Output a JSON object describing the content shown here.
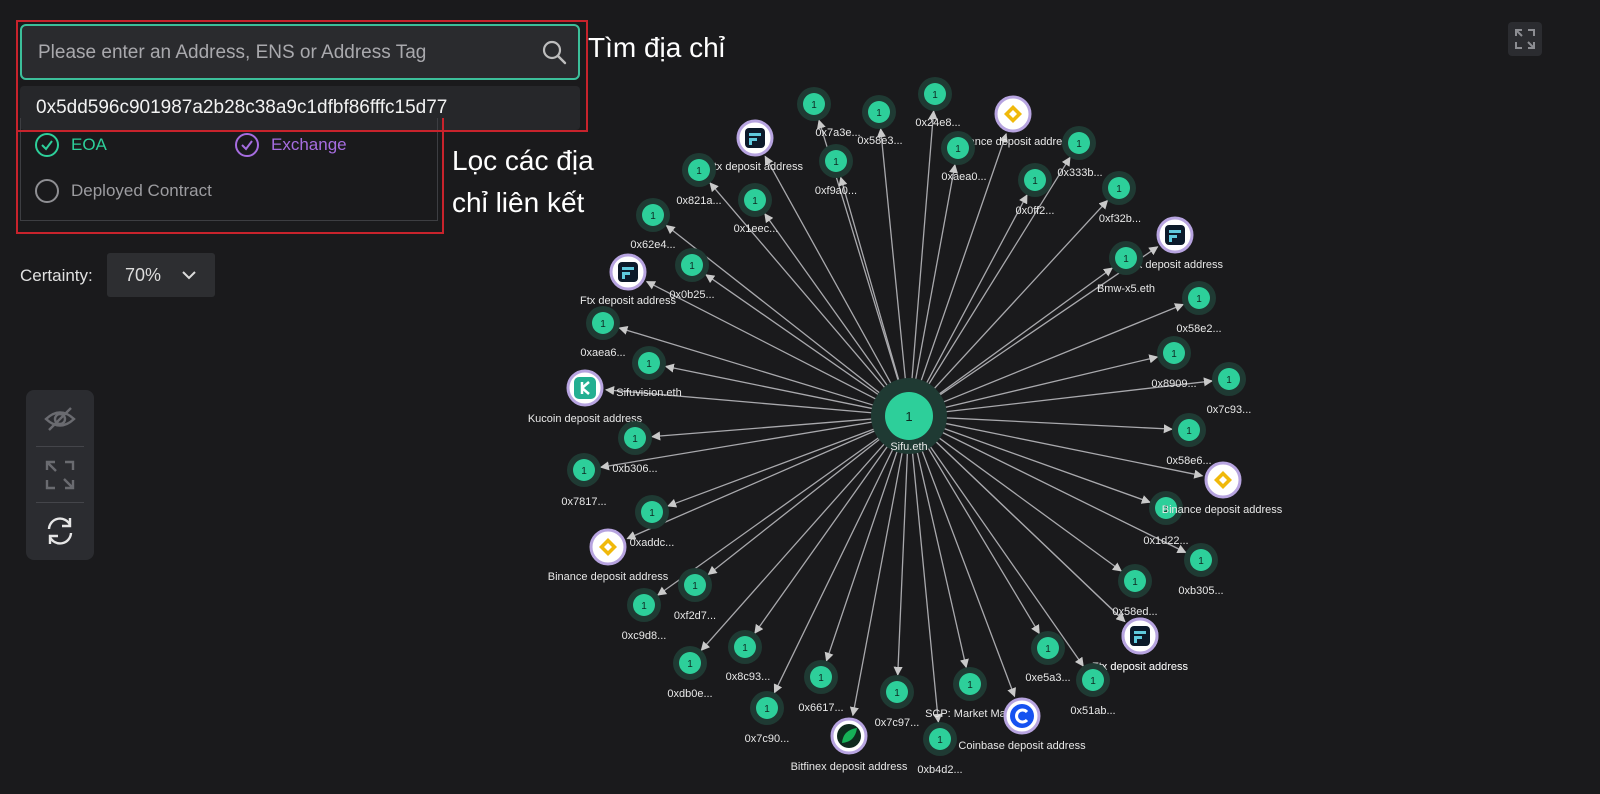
{
  "search": {
    "placeholder": "Please enter an Address, ENS or Address Tag",
    "suggestion": "0x5dd596c901987a2b28c38a9c1dfbf86fffc15d77"
  },
  "filters": {
    "eoa": "EOA",
    "exchange": "Exchange",
    "deployed_contract": "Deployed Contract"
  },
  "annotations": {
    "search": "Tìm địa chỉ",
    "filter_line1": "Lọc các địa",
    "filter_line2": "chỉ liên kết"
  },
  "certainty": {
    "label": "Certainty:",
    "value": "70%"
  },
  "toolbar": {
    "icons": [
      "eye-off-icon",
      "expand-icon",
      "refresh-icon"
    ]
  },
  "colors": {
    "eoa_node": "#2dcf9a",
    "exchange_ring": "#b7a4e0",
    "search_border": "#3cbf9a",
    "highlight_box": "#c8232c",
    "exchange_text": "#a66de0"
  },
  "graph": {
    "center": {
      "badge": "1",
      "label": "Sifu.eth"
    },
    "nodes": [
      {
        "type": "eoa",
        "badge": "1",
        "label": "0x7a3e..."
      },
      {
        "type": "eoa",
        "badge": "1",
        "label": "0x58e3..."
      },
      {
        "type": "eoa",
        "badge": "1",
        "label": "0x24e8..."
      },
      {
        "type": "exchange",
        "icon": "binance",
        "label": "Binance deposit address"
      },
      {
        "type": "eoa",
        "badge": "1",
        "label": "0xaea0..."
      },
      {
        "type": "eoa",
        "badge": "1",
        "label": "0x333b..."
      },
      {
        "type": "exchange",
        "icon": "ftx",
        "label": "Ftx deposit address"
      },
      {
        "type": "eoa",
        "badge": "1",
        "label": "0xf9a0..."
      },
      {
        "type": "eoa",
        "badge": "1",
        "label": "0x0ff2..."
      },
      {
        "type": "eoa",
        "badge": "1",
        "label": "0xf32b..."
      },
      {
        "type": "exchange",
        "icon": "ftx",
        "label": "Ftx deposit address"
      },
      {
        "type": "eoa",
        "badge": "1",
        "label": "0x821a..."
      },
      {
        "type": "eoa",
        "badge": "1",
        "label": "0x1eec..."
      },
      {
        "type": "exchange",
        "icon": "ftx",
        "label": "Ftx deposit address"
      },
      {
        "type": "eoa",
        "badge": "1",
        "label": "Bmw-x5.eth"
      },
      {
        "type": "eoa",
        "badge": "1",
        "label": "0x62e4..."
      },
      {
        "type": "eoa",
        "badge": "1",
        "label": "0x0b25..."
      },
      {
        "type": "exchange",
        "icon": "ftx",
        "label": "Ftx deposit address"
      },
      {
        "type": "eoa",
        "badge": "1",
        "label": "0x58e2..."
      },
      {
        "type": "eoa",
        "badge": "1",
        "label": "0xaea6..."
      },
      {
        "type": "eoa",
        "badge": "1",
        "label": "0x8909..."
      },
      {
        "type": "eoa",
        "badge": "1",
        "label": "Sifuvision.eth"
      },
      {
        "type": "exchange",
        "icon": "kucoin",
        "label": "Kucoin deposit address"
      },
      {
        "type": "eoa",
        "badge": "1",
        "label": "0x7c93..."
      },
      {
        "type": "eoa",
        "badge": "1",
        "label": "0xb306..."
      },
      {
        "type": "eoa",
        "badge": "1",
        "label": "0x58e6..."
      },
      {
        "type": "eoa",
        "badge": "1",
        "label": "0x7817..."
      },
      {
        "type": "exchange",
        "icon": "binance",
        "label": "Binance deposit address"
      },
      {
        "type": "eoa",
        "badge": "1",
        "label": "0xaddc..."
      },
      {
        "type": "eoa",
        "badge": "1",
        "label": "0x1d22..."
      },
      {
        "type": "exchange",
        "icon": "binance",
        "label": "Binance deposit address"
      },
      {
        "type": "eoa",
        "badge": "1",
        "label": "0xb305..."
      },
      {
        "type": "eoa",
        "badge": "1",
        "label": "0xf2d7..."
      },
      {
        "type": "eoa",
        "badge": "1",
        "label": "0x58ed..."
      },
      {
        "type": "eoa",
        "badge": "1",
        "label": "0xc9d8..."
      },
      {
        "type": "exchange",
        "icon": "ftx",
        "label": "Ftx deposit address"
      },
      {
        "type": "eoa",
        "badge": "1",
        "label": "0x8c93..."
      },
      {
        "type": "eoa",
        "badge": "1",
        "label": "0xe5a3..."
      },
      {
        "type": "eoa",
        "badge": "1",
        "label": "0xdb0e..."
      },
      {
        "type": "eoa",
        "badge": "1",
        "label": "0x51ab..."
      },
      {
        "type": "eoa",
        "badge": "1",
        "label": "0x6617..."
      },
      {
        "type": "eoa",
        "badge": "1",
        "label": "SCP: Market Ma..."
      },
      {
        "type": "exchange",
        "icon": "coinbase",
        "label": "Coinbase deposit address"
      },
      {
        "type": "eoa",
        "badge": "1",
        "label": "0x7c97..."
      },
      {
        "type": "eoa",
        "badge": "1",
        "label": "0x7c90..."
      },
      {
        "type": "exchange",
        "icon": "bitfinex",
        "label": "Bitfinex deposit address"
      },
      {
        "type": "eoa",
        "badge": "1",
        "label": "0xb4d2..."
      }
    ]
  }
}
